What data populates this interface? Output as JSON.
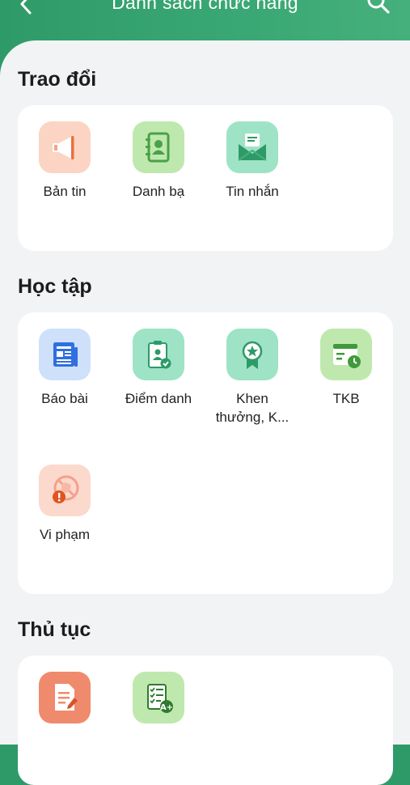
{
  "header": {
    "title": "Danh sách chức năng",
    "background_color": "#2e9a68"
  },
  "sections": [
    {
      "title": "Trao đổi",
      "items": [
        {
          "label": "Bản tin",
          "icon": "megaphone-icon"
        },
        {
          "label": "Danh bạ",
          "icon": "contact-book-icon"
        },
        {
          "label": "Tin nhắn",
          "icon": "message-envelope-icon"
        }
      ]
    },
    {
      "title": "Học tập",
      "items": [
        {
          "label": "Báo bài",
          "icon": "newspaper-icon"
        },
        {
          "label": "Điểm danh",
          "icon": "attendance-icon"
        },
        {
          "label": "Khen thưởng, K...",
          "icon": "award-ribbon-icon"
        },
        {
          "label": "TKB",
          "icon": "timetable-calendar-icon"
        },
        {
          "label": "Vi phạm",
          "icon": "violation-warning-icon"
        }
      ]
    },
    {
      "title": "Thủ tục",
      "items": [
        {
          "label": "",
          "icon": "document-edit-icon"
        },
        {
          "label": "",
          "icon": "grade-checklist-icon"
        }
      ]
    }
  ]
}
